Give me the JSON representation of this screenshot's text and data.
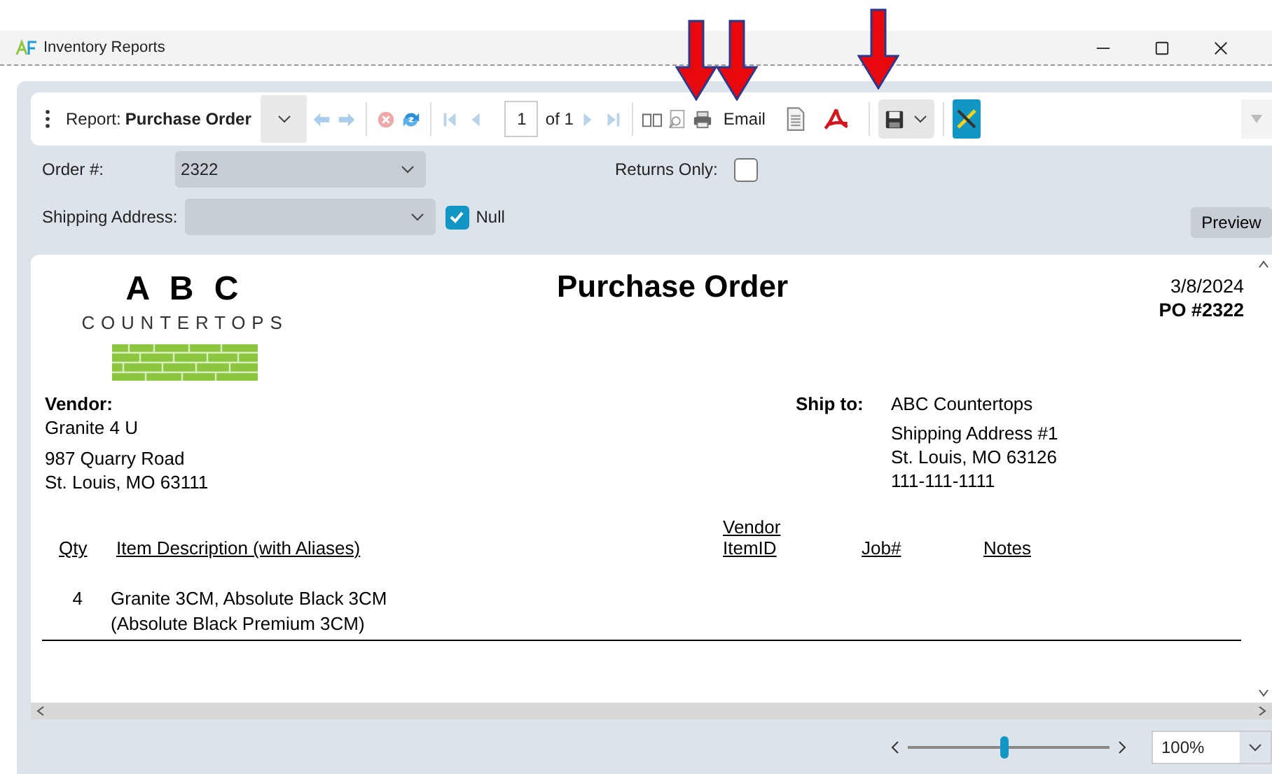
{
  "window": {
    "title": "Inventory Reports"
  },
  "toolbar": {
    "report_label": "Report:",
    "report_name": "Purchase Order",
    "page": "1",
    "page_of": "of 1",
    "email": "Email"
  },
  "filters": {
    "order_label": "Order #:",
    "order_value": "2322",
    "returns_label": "Returns Only:",
    "returns_only": false,
    "shipping_label": "Shipping Address:",
    "null_label": "Null",
    "null_checked": true,
    "preview": "Preview"
  },
  "report": {
    "logo_title": "A B C",
    "logo_subtitle": "COUNTERTOPS",
    "title": "Purchase Order",
    "date": "3/8/2024",
    "po": "PO #2322",
    "vendor_label": "Vendor:",
    "vendor_name": "Granite 4 U",
    "vendor_address": [
      "987 Quarry Road",
      "St. Louis, MO 63111"
    ],
    "ship_label": "Ship to:",
    "ship_name": "ABC Countertops",
    "ship_address": [
      "Shipping Address #1",
      "St. Louis, MO 63126",
      "111-111-1111"
    ],
    "columns": [
      "Qty",
      "Item Description (with Aliases)",
      "Vendor ItemID",
      "Job#",
      "Notes"
    ],
    "rows": [
      {
        "qty": "4",
        "description": [
          "Granite 3CM, Absolute Black 3CM",
          "(Absolute Black Premium 3CM)"
        ]
      }
    ]
  },
  "zoom": {
    "level": 0.48,
    "value": "100%"
  }
}
